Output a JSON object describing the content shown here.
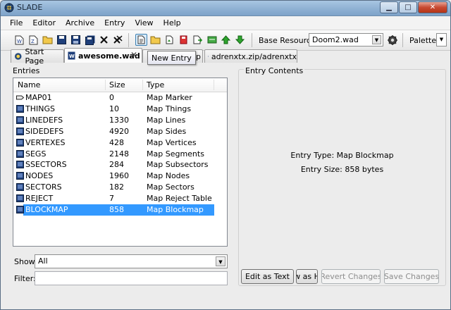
{
  "window": {
    "title": "SLADE"
  },
  "menubar": [
    "File",
    "Editor",
    "Archive",
    "Entry",
    "View",
    "Help"
  ],
  "toolbar": {
    "base_resource_label": "Base Resource:",
    "base_resource_value": "Doom2.wad",
    "palette_label": "Palette:"
  },
  "tooltip": "New Entry",
  "tabs": [
    {
      "label": "Start Page"
    },
    {
      "label": "awesome.wad"
    },
    {
      "label": "zip"
    },
    {
      "label": "adrenxtx.zip/adrenxtx"
    }
  ],
  "entries": {
    "group_label": "Entries",
    "columns": [
      "Name",
      "Size",
      "Type"
    ],
    "rows": [
      {
        "name": "MAP01",
        "size": "0",
        "type": "Map Marker",
        "icon": "map-marker-icon"
      },
      {
        "name": "THINGS",
        "size": "10",
        "type": "Map Things",
        "icon": "map-data-icon"
      },
      {
        "name": "LINEDEFS",
        "size": "1330",
        "type": "Map Lines",
        "icon": "map-data-icon"
      },
      {
        "name": "SIDEDEFS",
        "size": "4920",
        "type": "Map Sides",
        "icon": "map-data-icon"
      },
      {
        "name": "VERTEXES",
        "size": "428",
        "type": "Map Vertices",
        "icon": "map-data-icon"
      },
      {
        "name": "SEGS",
        "size": "2148",
        "type": "Map Segments",
        "icon": "map-data-icon"
      },
      {
        "name": "SSECTORS",
        "size": "284",
        "type": "Map Subsectors",
        "icon": "map-data-icon"
      },
      {
        "name": "NODES",
        "size": "1960",
        "type": "Map Nodes",
        "icon": "map-data-icon"
      },
      {
        "name": "SECTORS",
        "size": "182",
        "type": "Map Sectors",
        "icon": "map-data-icon"
      },
      {
        "name": "REJECT",
        "size": "7",
        "type": "Map Reject Table",
        "icon": "map-data-icon"
      },
      {
        "name": "BLOCKMAP",
        "size": "858",
        "type": "Map Blockmap",
        "icon": "map-data-icon",
        "selected": true
      }
    ],
    "show_label": "Show:",
    "show_value": "All",
    "filter_label": "Filter:",
    "filter_value": ""
  },
  "contents": {
    "group_label": "Entry Contents",
    "type_line": "Entry Type: Map Blockmap",
    "size_line": "Entry Size: 858 bytes",
    "buttons": {
      "edit_as_text": "Edit as Text",
      "view_as_hex": "w as H",
      "revert": "Revert Changes",
      "save": "Save Changes"
    }
  },
  "colors": {
    "selection": "#3399ff",
    "titlebar": "#8fb1d3",
    "close": "#c84a32"
  }
}
